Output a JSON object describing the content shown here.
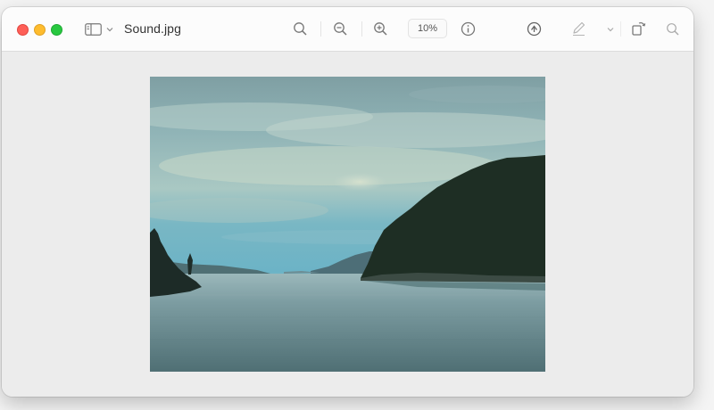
{
  "window": {
    "title": "Sound.jpg"
  },
  "toolbar": {
    "zoom_value": "10%",
    "icons": [
      "sidebar-toggle-icon",
      "chevron-down-icon",
      "zoom-fit-icon",
      "zoom-out-icon",
      "zoom-in-icon",
      "info-icon",
      "share-icon",
      "markup-icon",
      "rotate-icon",
      "search-icon"
    ]
  },
  "colors": {
    "close": "#fe5f57",
    "minimize": "#febc2e",
    "maximize": "#28c840",
    "toolbar_bg": "#fcfcfc",
    "canvas_bg": "#ececec"
  },
  "image": {
    "content": "photo"
  }
}
